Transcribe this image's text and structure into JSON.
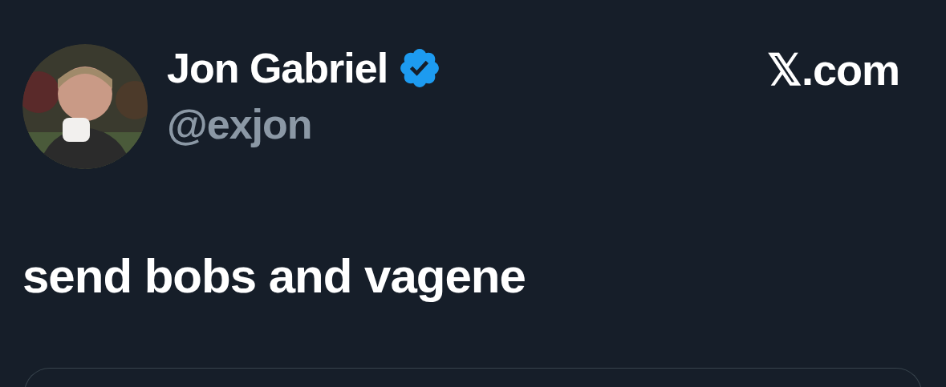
{
  "author": {
    "name": "Jon Gabriel",
    "verified": true,
    "handle": "@exjon"
  },
  "source": "𝕏.com",
  "text": "send bobs and vagene"
}
